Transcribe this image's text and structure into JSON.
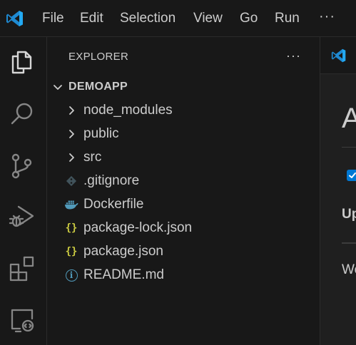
{
  "menu": {
    "items": [
      "File",
      "Edit",
      "Selection",
      "View",
      "Go",
      "Run"
    ],
    "more": "···"
  },
  "activity_bar": {
    "icons": [
      "explorer-icon",
      "search-icon",
      "source-control-icon",
      "run-debug-icon",
      "extensions-icon",
      "remote-explorer-icon"
    ],
    "active": "explorer-icon"
  },
  "sidebar": {
    "title": "EXPLORER",
    "more": "···",
    "folder": "DEMOAPP",
    "items": [
      {
        "label": "node_modules",
        "kind": "folder",
        "icon": "chevron-right-icon"
      },
      {
        "label": "public",
        "kind": "folder",
        "icon": "chevron-right-icon"
      },
      {
        "label": "src",
        "kind": "folder",
        "icon": "chevron-right-icon"
      },
      {
        "label": ".gitignore",
        "kind": "file",
        "icon": "git-icon"
      },
      {
        "label": "Dockerfile",
        "kind": "file",
        "icon": "docker-icon"
      },
      {
        "label": "package-lock.json",
        "kind": "file",
        "icon": "json-icon"
      },
      {
        "label": "package.json",
        "kind": "file",
        "icon": "json-icon"
      },
      {
        "label": "README.md",
        "kind": "file",
        "icon": "info-icon"
      }
    ]
  },
  "editor": {
    "heading": "A",
    "subheading": "Up",
    "text": "We"
  },
  "colors": {
    "background": "#181818",
    "editor_background": "#1f1f1f",
    "text": "#cccccc",
    "accent": "#0078d4",
    "vscode_blue": "#23a9f2",
    "json_yellow": "#cbcb41",
    "docker_blue": "#519aba",
    "git_gray": "#41535b"
  }
}
